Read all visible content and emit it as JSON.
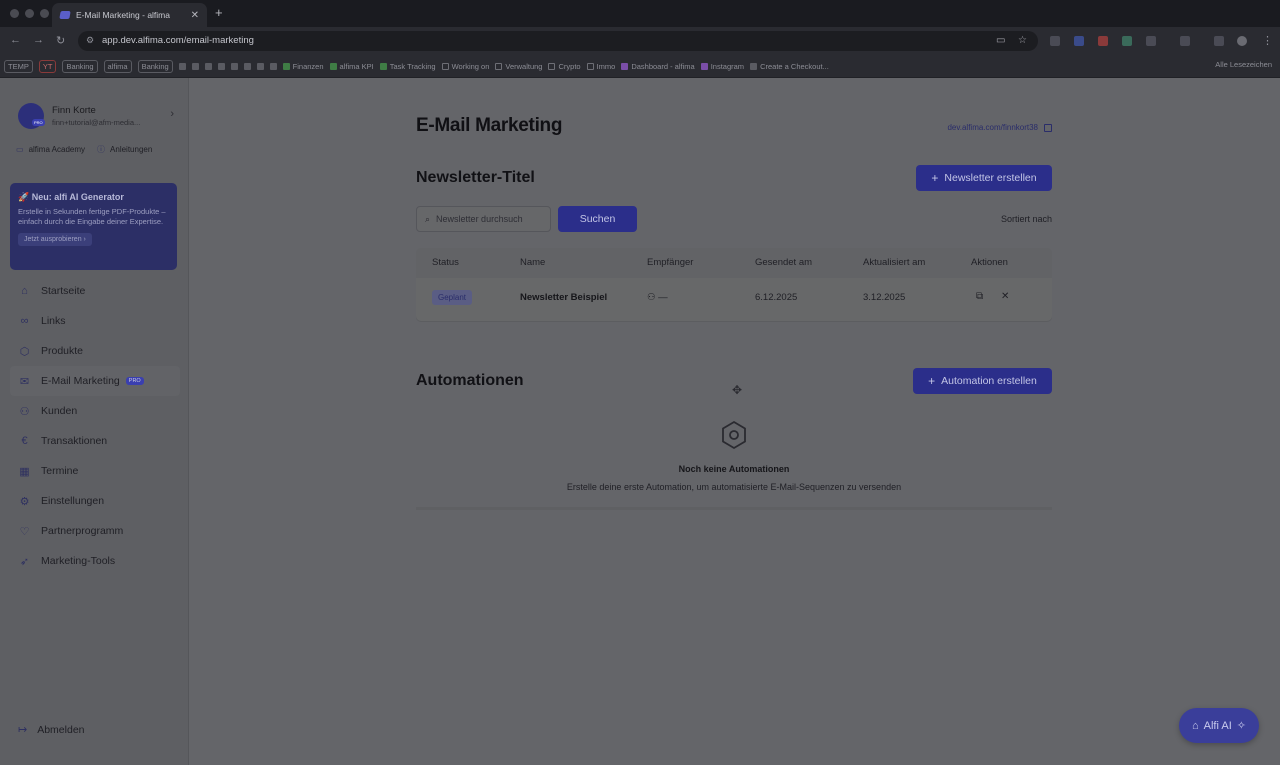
{
  "browser": {
    "tab_title": "E-Mail Marketing - alfima",
    "url": "app.dev.alfima.com/email-marketing",
    "bookmarks": [
      {
        "label": "TEMP",
        "kind": "chip"
      },
      {
        "label": "YT",
        "kind": "chip-red"
      },
      {
        "label": "Banking",
        "kind": "chip"
      },
      {
        "label": "alfima",
        "kind": "chip"
      },
      {
        "label": "Banking",
        "kind": "chip"
      },
      {
        "label": "Finanzen",
        "kind": "green"
      },
      {
        "label": "alfima KPI",
        "kind": "green"
      },
      {
        "label": "Task Tracking",
        "kind": "green"
      },
      {
        "label": "Working on",
        "kind": "folder"
      },
      {
        "label": "Verwaltung",
        "kind": "folder"
      },
      {
        "label": "Crypto",
        "kind": "folder"
      },
      {
        "label": "Immo",
        "kind": "folder"
      },
      {
        "label": "Dashboard - alfima",
        "kind": "purple"
      },
      {
        "label": "Instagram",
        "kind": "purple"
      },
      {
        "label": "Create a Checkout...",
        "kind": "plain"
      }
    ],
    "all_bookmarks": "Alle Lesezeichen"
  },
  "sidebar": {
    "profile_name": "Finn Korte",
    "profile_email": "finn+tutorial@afm-media...",
    "quick_links": [
      {
        "label": "alfima Academy",
        "icon": "video-icon"
      },
      {
        "label": "Anleitungen",
        "icon": "help-icon"
      }
    ],
    "promo": {
      "title": "🚀 Neu: alfi AI Generator",
      "text": "Erstelle in Sekunden fertige PDF-Produkte – einfach durch die Eingabe deiner Expertise.",
      "button": "Jetzt ausprobieren"
    },
    "nav": [
      {
        "label": "Startseite",
        "icon": "home-icon"
      },
      {
        "label": "Links",
        "icon": "link-icon"
      },
      {
        "label": "Produkte",
        "icon": "box-icon"
      },
      {
        "label": "E-Mail Marketing",
        "icon": "mail-icon",
        "badge": "PRO",
        "active": true
      },
      {
        "label": "Kunden",
        "icon": "users-icon"
      },
      {
        "label": "Transaktionen",
        "icon": "euro-icon"
      },
      {
        "label": "Termine",
        "icon": "calendar-icon"
      },
      {
        "label": "Einstellungen",
        "icon": "gear-icon"
      },
      {
        "label": "Partnerprogramm",
        "icon": "handshake-icon"
      },
      {
        "label": "Marketing-Tools",
        "icon": "rocket-icon"
      }
    ],
    "logout": "Abmelden"
  },
  "main": {
    "title": "E-Mail Marketing",
    "public_link": "dev.alfima.com/finnkort38",
    "newsletter": {
      "title": "Newsletter-Titel",
      "create_button": "Newsletter erstellen",
      "search_placeholder": "Newsletter durchsuch",
      "search_button": "Suchen",
      "sort_label": "Sortiert nach",
      "columns": [
        "Status",
        "Name",
        "Empfänger",
        "Gesendet am",
        "Aktualisiert am",
        "Aktionen"
      ],
      "rows": [
        {
          "status": "Geplant",
          "name": "Newsletter Beispiel",
          "recipients": "—",
          "sent": "6.12.2025",
          "updated": "3.12.2025"
        }
      ]
    },
    "automations": {
      "title": "Automationen",
      "create_button": "Automation erstellen",
      "empty_title": "Noch keine Automationen",
      "empty_text": "Erstelle deine erste Automation, um automatisierte E-Mail-Sequenzen zu versenden"
    }
  },
  "assistant_button": "Alfi AI",
  "colors": {
    "primary": "#2b2e8a",
    "overlay_bg": "#646569",
    "promo_bg": "#2c2f66"
  }
}
